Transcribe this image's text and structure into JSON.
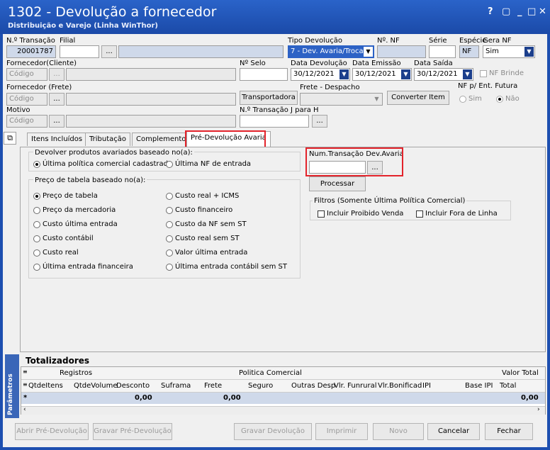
{
  "window": {
    "title": "1302 - Devolução a fornecedor",
    "subtitle": "Distribuição e Varejo (Linha WinThor)",
    "controls": [
      "?",
      "▢",
      "_",
      "□",
      "✕"
    ]
  },
  "header": {
    "transacao_label": "N.º Transação",
    "transacao_value": "20001787",
    "filial_label": "Filial",
    "tipo_devolucao_label": "Tipo Devolução",
    "tipo_devolucao_value": "7 - Dev. Avaria/Trocas",
    "nf_label": "Nº. NF",
    "serie_label": "Série",
    "especie_label": "Espécie",
    "especie_value": "NF",
    "gera_nf_label": "Gera NF",
    "gera_nf_value": "Sim",
    "fornecedor_cliente_label": "Fornecedor(Cliente)",
    "codigo_placeholder": "Código",
    "selo_label": "Nº Selo",
    "data_devolucao_label": "Data Devolução",
    "data_devolucao_value": "30/12/2021",
    "data_emissao_label": "Data Emissão",
    "data_emissao_value": "30/12/2021",
    "data_saida_label": "Data Saída",
    "data_saida_value": "30/12/2021",
    "nf_brinde_label": "NF Brinde",
    "fornecedor_frete_label": "Fornecedor (Frete)",
    "transportadora_label": "Transportadora",
    "frete_despacho_label": "Frete - Despacho",
    "converter_item_label": "Converter Item",
    "nf_ent_futura_label": "NF p/ Ent. Futura",
    "sim_label": "Sim",
    "nao_label": "Não",
    "motivo_label": "Motivo",
    "transacao_j_label": "N.º Transação J para H",
    "ellipsis": "..."
  },
  "tabs": [
    {
      "label": "Itens Incluídos"
    },
    {
      "label": "Tributação"
    },
    {
      "label": "Complemento"
    },
    {
      "label": "Pré-Devolução Avaria"
    }
  ],
  "pre_devolucao": {
    "devolver_label": "Devolver produtos avariados baseado no(a):",
    "opt_politica": "Última política comercial cadastrada",
    "opt_nf_entrada": "Última NF de entrada",
    "preco_label": "Preço de tabela baseado no(a):",
    "precos": [
      "Preço de tabela",
      "Custo real + ICMS",
      "Preço da mercadoria",
      "Custo financeiro",
      "Custo última entrada",
      "Custo da NF sem ST",
      "Custo contábil",
      "Custo real sem ST",
      "Custo real",
      "Valor última entrada",
      "Última entrada financeira",
      "Última entrada contábil sem ST"
    ],
    "num_transacao_label": "Num.Transação Dev.Avaria",
    "processar_label": "Processar",
    "filtros_label": "Filtros (Somente Última Política Comercial)",
    "incluir_proibido": "Incluir Proibido Venda",
    "incluir_fora_linha": "Incluir Fora de Linha"
  },
  "totalizadores": {
    "title": "Totalizadores",
    "side_label": "Parâmetros",
    "group_registros": "Registros",
    "group_politica": "Politica Comercial",
    "group_valor_total": "Valor Total",
    "columns": [
      "QtdeItens",
      "QtdeVolume",
      "Desconto",
      "Suframa",
      "Frete",
      "Seguro",
      "Outras Desp",
      "Vlr. Funrural",
      "Vlr.Bonificad",
      "IPI",
      "Base IPI",
      "Total"
    ],
    "row_marker": "*",
    "desconto_value": "0,00",
    "frete_value": "0,00",
    "total_value": "0,00"
  },
  "footer": {
    "abrir": "Abrir Pré-Devolução",
    "gravar_pre": "Gravar Pré-Devolução",
    "gravar_dev": "Gravar Devolução",
    "imprimir": "Imprimir",
    "novo": "Novo",
    "cancelar": "Cancelar",
    "fechar": "Fechar"
  },
  "colors": {
    "title_bg": "#1d4fb0",
    "highlight": "#e3232b",
    "readonly_field": "#cfd9ea"
  }
}
